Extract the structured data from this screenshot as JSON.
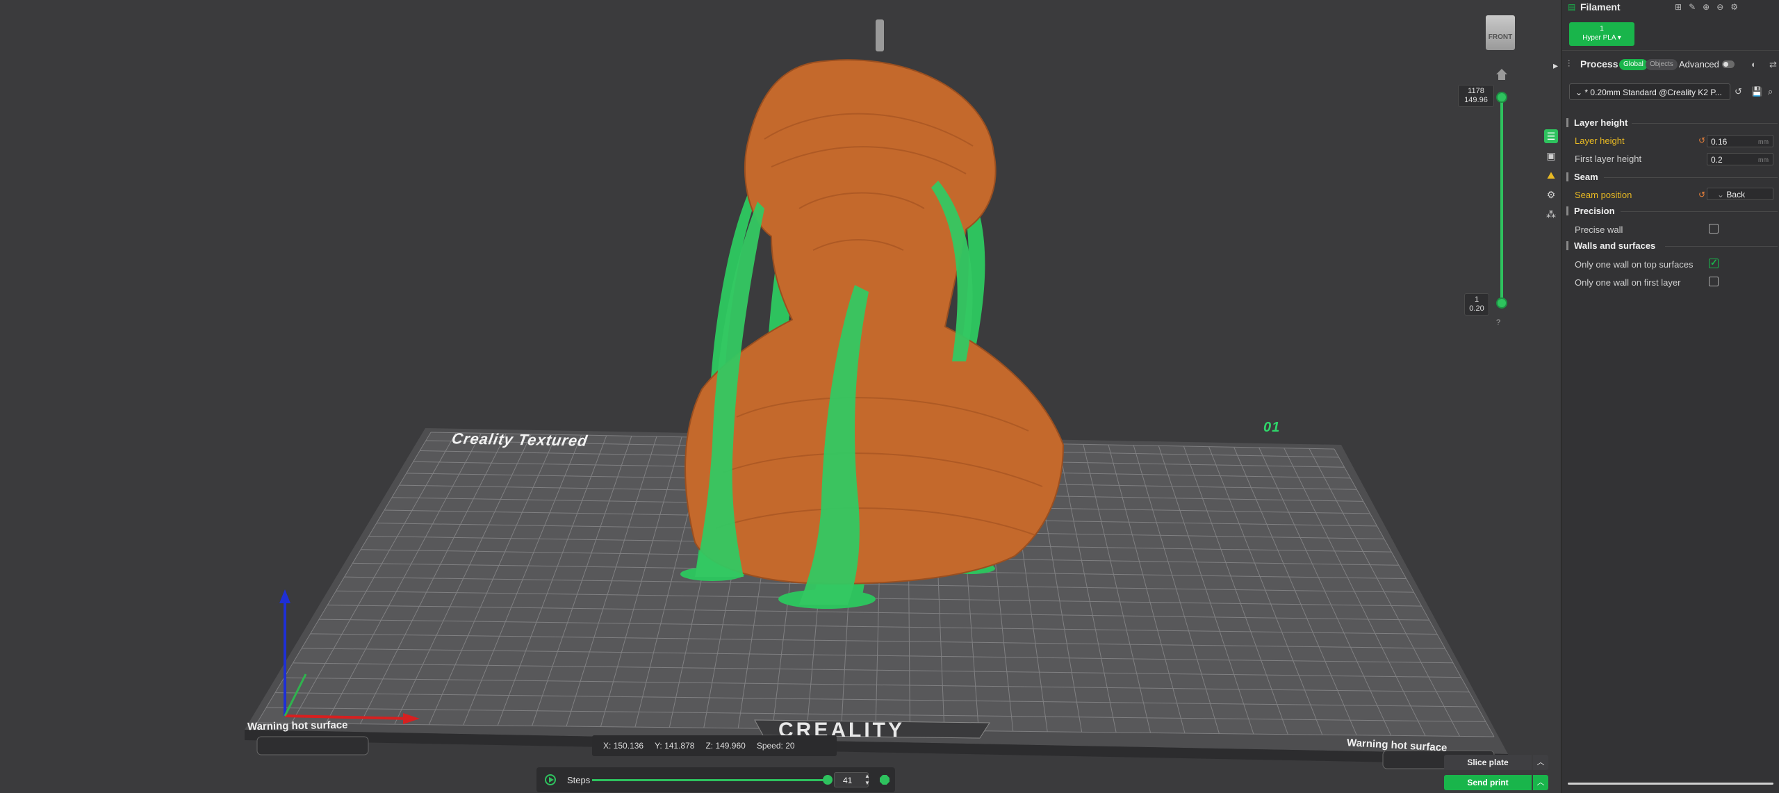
{
  "viewport": {
    "plate_name": "Creality Textured",
    "plate_number": "01",
    "warning_left": "Warning hot surface",
    "warning_right": "Warning hot surface",
    "brand": "CREALITY",
    "view_cube_label": "FRONT",
    "layer_top": {
      "layer": "1178",
      "height": "149.96"
    },
    "layer_bottom": {
      "layer": "1",
      "height": "0.20"
    },
    "slider_help": "?",
    "coords": {
      "x": "X: 150.136",
      "y": "Y: 141.878",
      "z": "Z: 149.960",
      "speed": "Speed: 20"
    },
    "steps_label": "Steps",
    "steps_value": "41",
    "slice_label": "Slice plate",
    "send_label": "Send print"
  },
  "panel": {
    "filament_title": "Filament",
    "filament_chip": {
      "index": "1",
      "name": "Hyper PLA"
    },
    "process_title": "Process",
    "seg_global": "Global",
    "seg_objects": "Objects",
    "advanced_label": "Advanced",
    "preset": "* 0.20mm Standard @Creality K2 P...",
    "sections": {
      "layer_height": "Layer height",
      "seam": "Seam",
      "precision": "Precision",
      "walls": "Walls and surfaces"
    },
    "settings": {
      "layer_height": {
        "label": "Layer height",
        "value": "0.16",
        "unit": "mm"
      },
      "first_layer_height": {
        "label": "First layer height",
        "value": "0.2",
        "unit": "mm"
      },
      "seam_position": {
        "label": "Seam position",
        "value": "Back"
      },
      "precise_wall": {
        "label": "Precise wall",
        "checked": false
      },
      "one_wall_top": {
        "label": "Only one wall on top surfaces",
        "checked": true
      },
      "one_wall_first": {
        "label": "Only one wall on first layer",
        "checked": false
      }
    }
  },
  "colors": {
    "accent": "#19b54b",
    "model": "#c4692c",
    "support": "#2ec25e",
    "modified": "#e8b923"
  }
}
